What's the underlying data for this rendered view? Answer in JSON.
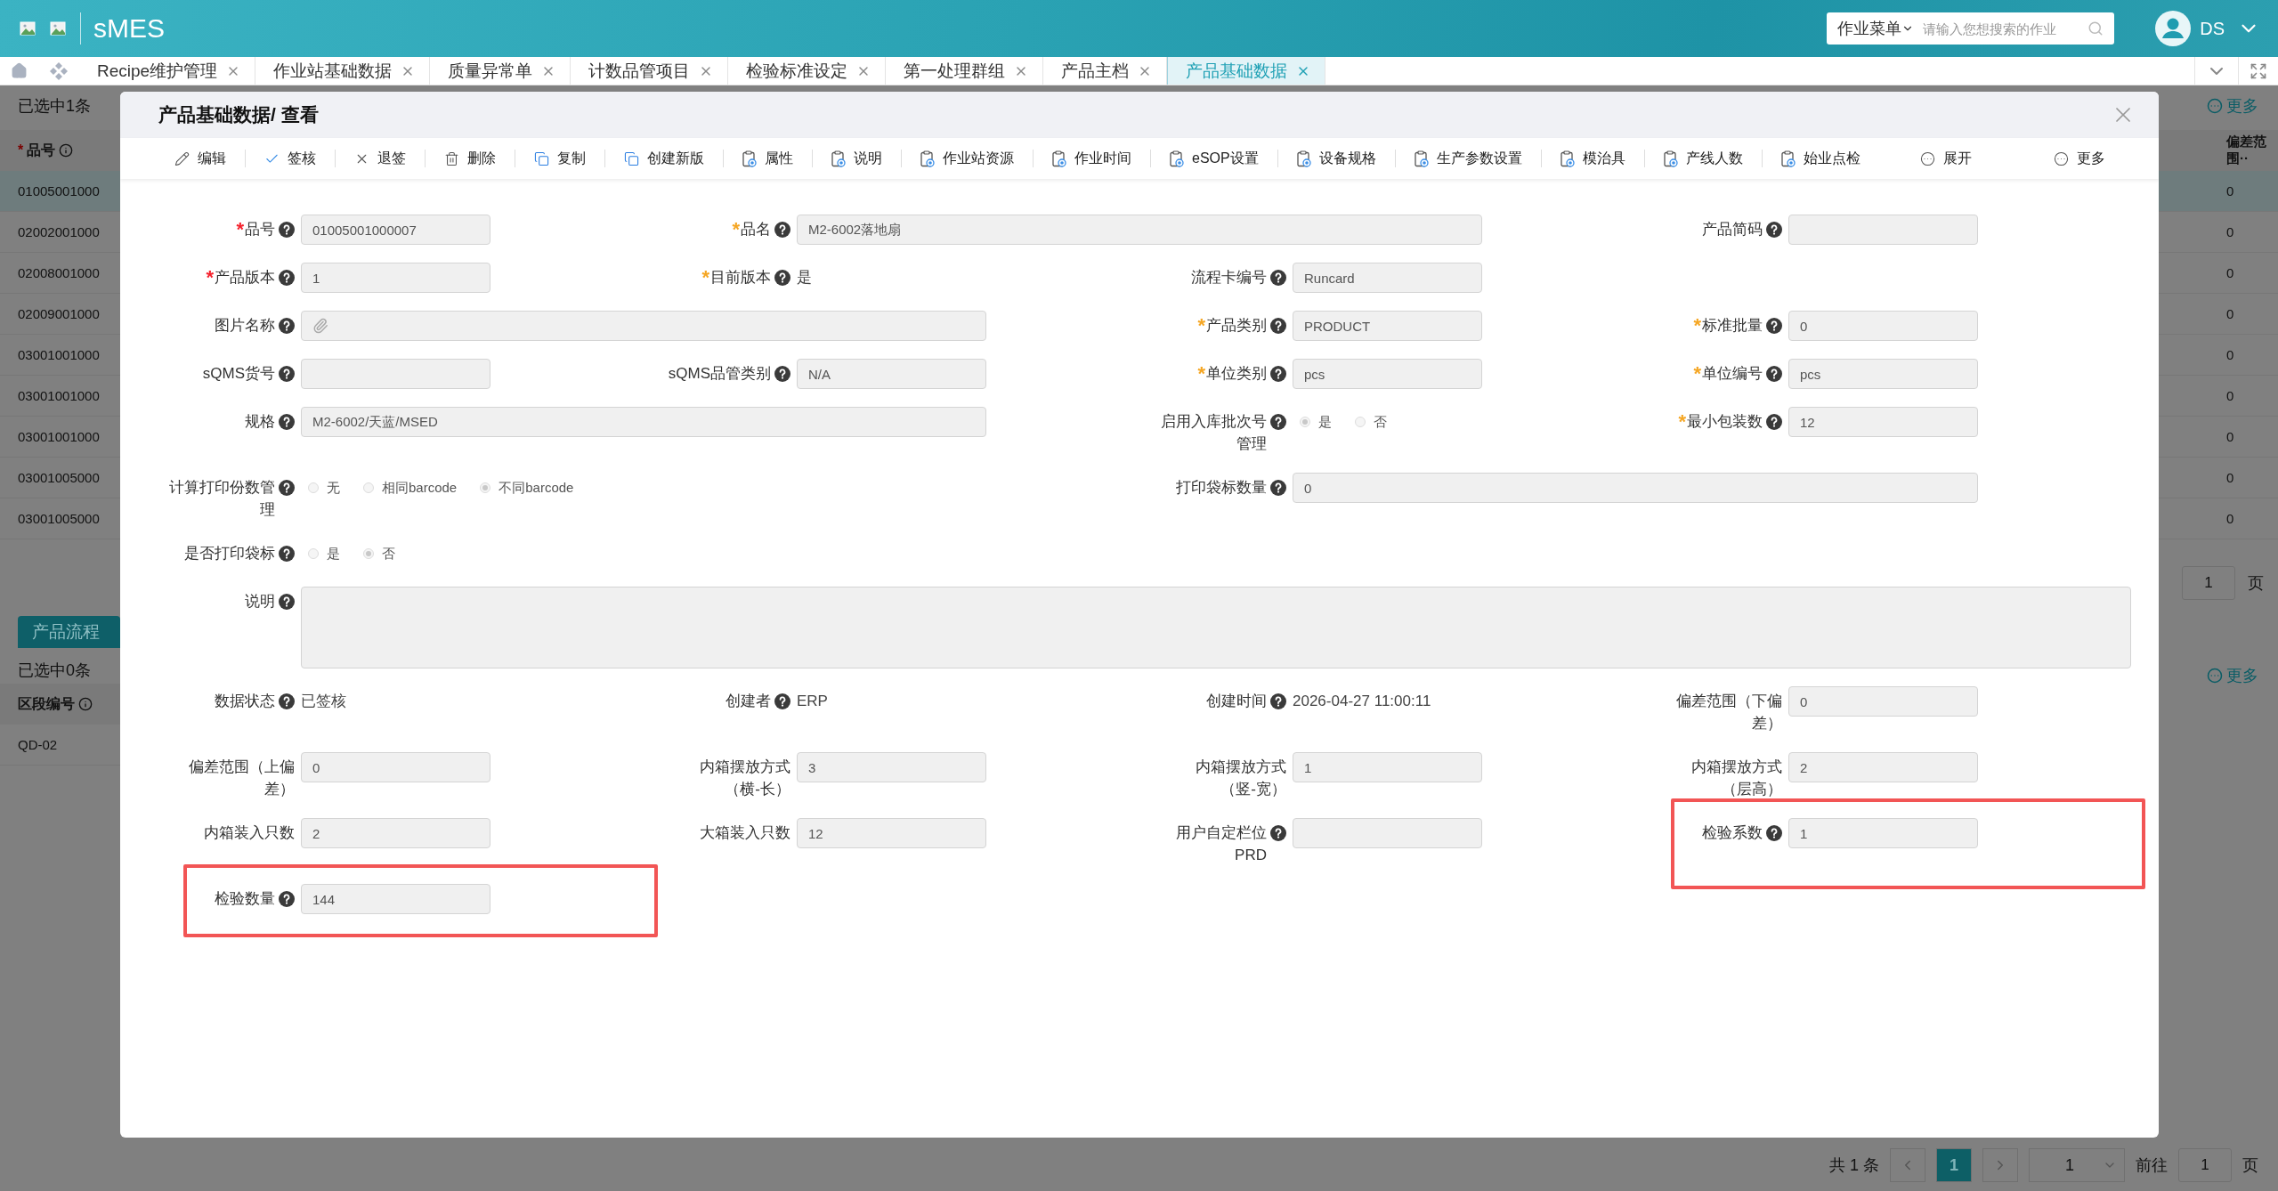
{
  "header": {
    "logo": "sMES",
    "search": {
      "menu": "作业菜单",
      "placeholder": "请输入您想搜索的作业"
    },
    "user": "DS"
  },
  "tabs": [
    {
      "label": "Recipe维护管理",
      "selected": false
    },
    {
      "label": "作业站基础数据",
      "selected": false
    },
    {
      "label": "质量异常单",
      "selected": false
    },
    {
      "label": "计数品管项目",
      "selected": false
    },
    {
      "label": "检验标准设定",
      "selected": false
    },
    {
      "label": "第一处理群组",
      "selected": false
    },
    {
      "label": "产品主档",
      "selected": false
    },
    {
      "label": "产品基础数据",
      "selected": true
    }
  ],
  "background": {
    "selection": "已选中1条",
    "column": "品号",
    "column_star": "*",
    "column_right": "偏差范围··",
    "more": "更多",
    "rows": [
      {
        "code": "01005001000",
        "deviation": "0",
        "selected": true
      },
      {
        "code": "02002001000",
        "deviation": "0",
        "selected": false
      },
      {
        "code": "02008001000",
        "deviation": "0",
        "selected": false
      },
      {
        "code": "02009001000",
        "deviation": "0",
        "selected": false
      },
      {
        "code": "03001001000",
        "deviation": "0",
        "selected": false
      },
      {
        "code": "03001001000",
        "deviation": "0",
        "selected": false
      },
      {
        "code": "03001001000",
        "deviation": "0",
        "selected": false
      },
      {
        "code": "03001005000",
        "deviation": "0",
        "selected": false
      },
      {
        "code": "03001005000",
        "deviation": "0",
        "selected": false
      }
    ],
    "mid_page_input": "1",
    "mid_page_unit": "页",
    "flow_tab": "产品流程",
    "selection_2": "已选中0条",
    "column_2": "区段编号",
    "more_2": "更多",
    "rows_2": [
      "QD-02"
    ],
    "pagination": {
      "total": "共 1 条",
      "current": "1",
      "page_size": "1",
      "goto": "前往",
      "page_input": "1",
      "page_unit": "页"
    }
  },
  "dialog": {
    "title": "产品基础数据/ 查看",
    "toolbar": [
      {
        "label": "编辑",
        "kind": "edit"
      },
      {
        "label": "签核",
        "kind": "sign"
      },
      {
        "label": "退签",
        "kind": "unsign"
      },
      {
        "label": "删除",
        "kind": "delete"
      },
      {
        "label": "复制",
        "kind": "copy"
      },
      {
        "label": "创建新版",
        "kind": "copy"
      },
      {
        "label": "属性",
        "kind": "doc"
      },
      {
        "label": "说明",
        "kind": "doc"
      },
      {
        "label": "作业站资源",
        "kind": "doc"
      },
      {
        "label": "作业时间",
        "kind": "doc"
      },
      {
        "label": "eSOP设置",
        "kind": "doc"
      },
      {
        "label": "设备规格",
        "kind": "doc"
      },
      {
        "label": "生产参数设置",
        "kind": "doc"
      },
      {
        "label": "模治具",
        "kind": "doc"
      },
      {
        "label": "产线人数",
        "kind": "doc"
      },
      {
        "label": "始业点检",
        "kind": "doc"
      },
      {
        "label": "展开",
        "kind": "more"
      },
      {
        "label": "更多",
        "kind": "more"
      }
    ],
    "rows": [
      [
        {
          "kind": "input",
          "label": "品号",
          "star": "*",
          "color": "#f5222d",
          "help": true,
          "value": "01005001000007"
        },
        {
          "kind": "wide_input",
          "label": "品名",
          "star": "*",
          "color": "#f5a623",
          "help": true,
          "value": "M2-6002落地扇"
        },
        {
          "kind": "input",
          "label": "产品简码",
          "help": true
        }
      ],
      [
        {
          "kind": "input",
          "label": "产品版本",
          "star": "*",
          "color": "#f5222d",
          "help": true,
          "value": "1"
        },
        {
          "kind": "text",
          "label": "目前版本",
          "star": "*",
          "color": "#f5a623",
          "help": true,
          "value": "是"
        },
        {
          "kind": "input",
          "label": "流程卡编号",
          "help": true,
          "value": "Runcard"
        }
      ],
      [
        {
          "kind": "attachment",
          "label": "图片名称",
          "help": true
        },
        {
          "kind": "input",
          "label": "产品类别",
          "star": "*",
          "color": "#f5a623",
          "help": true,
          "value": "PRODUCT"
        },
        {
          "kind": "input",
          "label": "标准批量",
          "star": "*",
          "color": "#f5a623",
          "help": true,
          "value": "0"
        }
      ],
      [
        {
          "kind": "input",
          "label": "sQMS货号",
          "help": true
        },
        {
          "kind": "input",
          "label": "sQMS品管类别",
          "help": true,
          "value": "N/A"
        },
        {
          "kind": "input",
          "label": "单位类别",
          "star": "*",
          "color": "#f5a623",
          "help": true,
          "value": "pcs"
        },
        {
          "kind": "input",
          "label": "单位编号",
          "star": "*",
          "color": "#f5a623",
          "help": true,
          "value": "pcs"
        }
      ],
      [
        {
          "kind": "wide_input",
          "label": "规格",
          "help": true,
          "value": "M2-6002/天蓝/MSED"
        },
        {
          "kind": "radio",
          "label": "启用入库批次号管理",
          "help": true,
          "options": [
            {
              "label": "是",
              "selected": true
            },
            {
              "label": "否",
              "selected": false
            }
          ]
        },
        {
          "kind": "input",
          "label": "最小包装数",
          "star": "*",
          "color": "#f5a623",
          "help": true,
          "value": "12"
        }
      ],
      [
        {
          "kind": "radio",
          "label": "计算打印份数管理",
          "help": true,
          "options": [
            {
              "label": "无",
              "selected": false
            },
            {
              "label": "相同barcode",
              "selected": false
            },
            {
              "label": "不同barcode",
              "selected": true
            }
          ]
        },
        {
          "kind": "blank"
        },
        {
          "kind": "wide_input",
          "label": "打印袋标数量",
          "help": true,
          "value": "0"
        }
      ],
      [
        {
          "kind": "radio",
          "label": "是否打印袋标",
          "help": true,
          "options": [
            {
              "label": "是",
              "selected": false
            },
            {
              "label": "否",
              "selected": true
            }
          ]
        }
      ],
      [
        {
          "kind": "textarea",
          "label": "说明",
          "help": true
        }
      ],
      [
        {
          "kind": "text",
          "label": "数据状态",
          "help": true,
          "value": "已签核"
        },
        {
          "kind": "text",
          "label": "创建者",
          "help": true,
          "value": "ERP"
        },
        {
          "kind": "text",
          "label": "创建时间",
          "help": true,
          "value": "2026-04-27 11:00:11"
        },
        {
          "kind": "input",
          "label": "偏差范围（下偏差）",
          "help": false,
          "value": "0"
        }
      ],
      [
        {
          "kind": "input",
          "label": "偏差范围（上偏差）",
          "help": false,
          "value": "0"
        },
        {
          "kind": "input",
          "label": "内箱摆放方式（横-长）",
          "help": false,
          "value": "3"
        },
        {
          "kind": "input",
          "label": "内箱摆放方式（竖-宽）",
          "help": false,
          "value": "1"
        },
        {
          "kind": "input",
          "label": "内箱摆放方式（层高）",
          "help": false,
          "value": "2"
        }
      ],
      [
        {
          "kind": "input",
          "label": "内箱装入只数",
          "help": false,
          "value": "2"
        },
        {
          "kind": "input",
          "label": "大箱装入只数",
          "help": false,
          "value": "12"
        },
        {
          "kind": "input",
          "label": "用户自定栏位PRD",
          "help": true
        },
        {
          "kind": "input",
          "label": "检验系数",
          "help": true,
          "value": "1",
          "highlighted": true
        }
      ],
      [
        {
          "kind": "input",
          "label": "检验数量",
          "help": true,
          "value": "144",
          "highlighted": true
        }
      ]
    ]
  }
}
